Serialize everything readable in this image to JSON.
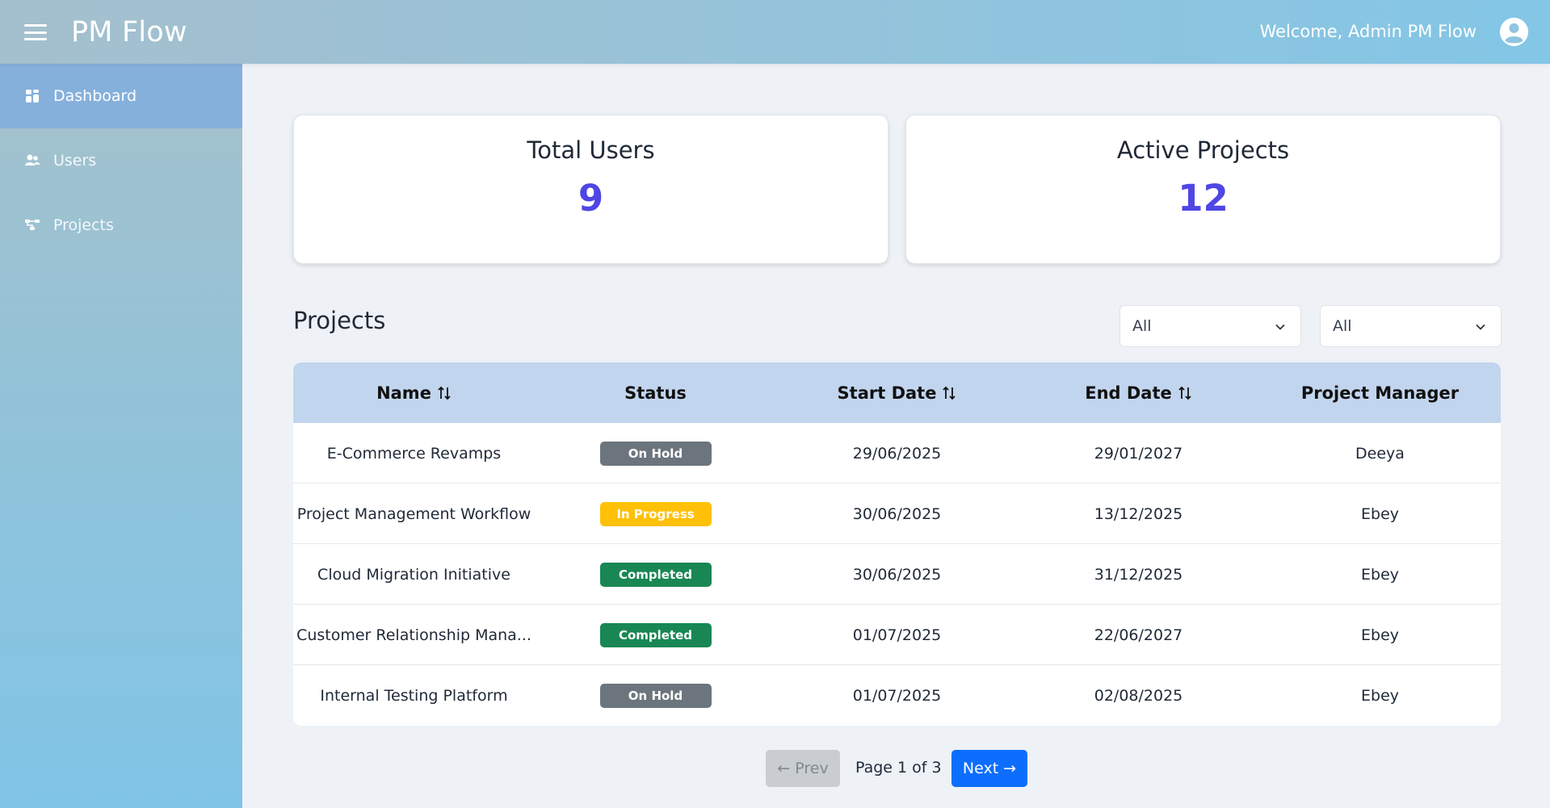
{
  "app": {
    "brand": "PM Flow",
    "welcome": "Welcome, Admin PM Flow"
  },
  "sidebar": {
    "items": [
      {
        "label": "Dashboard",
        "icon": "dashboard-icon",
        "active": true
      },
      {
        "label": "Users",
        "icon": "users-icon",
        "active": false
      },
      {
        "label": "Projects",
        "icon": "projects-icon",
        "active": false
      }
    ]
  },
  "stats": {
    "total_users": {
      "label": "Total Users",
      "value": "9"
    },
    "active_projects": {
      "label": "Active Projects",
      "value": "12"
    }
  },
  "projects": {
    "title": "Projects",
    "filters": [
      "All",
      "All"
    ],
    "columns": [
      "Name",
      "Status",
      "Start Date",
      "End Date",
      "Project Manager"
    ],
    "rows": [
      {
        "name": "E-Commerce Revamps",
        "status": "On Hold",
        "start": "29/06/2025",
        "end": "29/01/2027",
        "manager": "Deeya"
      },
      {
        "name": "Project Management Workflow",
        "status": "In Progress",
        "start": "30/06/2025",
        "end": "13/12/2025",
        "manager": "Ebey"
      },
      {
        "name": "Cloud Migration Initiative",
        "status": "Completed",
        "start": "30/06/2025",
        "end": "31/12/2025",
        "manager": "Ebey"
      },
      {
        "name": "Customer Relationship Mana...",
        "status": "Completed",
        "start": "01/07/2025",
        "end": "22/06/2027",
        "manager": "Ebey"
      },
      {
        "name": "Internal Testing Platform",
        "status": "On Hold",
        "start": "01/07/2025",
        "end": "02/08/2025",
        "manager": "Ebey"
      }
    ]
  },
  "status_colors": {
    "On Hold": "#6c757d",
    "In Progress": "#ffc107",
    "Completed": "#198754"
  },
  "pagination": {
    "prev": "← Prev",
    "info": "Page 1 of 3",
    "next": "Next →"
  },
  "colors": {
    "accent": "#4f46e5",
    "primary": "#0d6efd"
  }
}
